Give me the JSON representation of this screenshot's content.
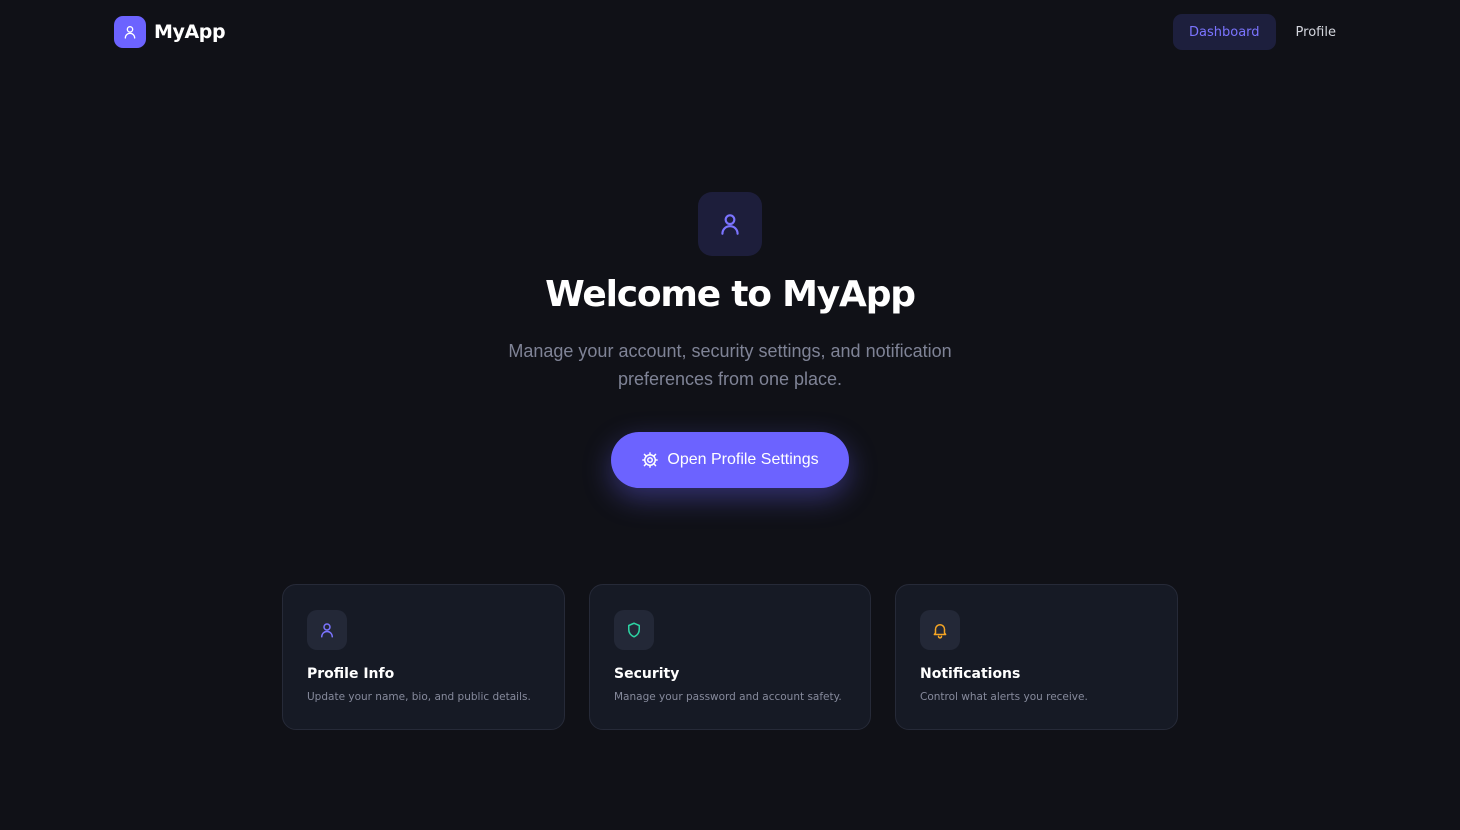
{
  "app": {
    "name": "MyApp",
    "accent_color": "#6c63ff",
    "background_color": "#101117"
  },
  "nav": {
    "items": [
      {
        "label": "Dashboard",
        "active": true
      },
      {
        "label": "Profile",
        "active": false
      }
    ]
  },
  "hero": {
    "icon": "user-icon",
    "title": "Welcome to MyApp",
    "subtitle": "Manage your account, security settings, and notification preferences from one place.",
    "cta": {
      "label": "Open Profile Settings",
      "icon": "gear-icon"
    }
  },
  "cards": [
    {
      "icon": "user-icon",
      "icon_color": "#7b74ff",
      "title": "Profile Info",
      "description": "Update your name, bio, and public details."
    },
    {
      "icon": "shield-icon",
      "icon_color": "#2dd4a3",
      "title": "Security",
      "description": "Manage your password and account safety."
    },
    {
      "icon": "bell-icon",
      "icon_color": "#f5a524",
      "title": "Notifications",
      "description": "Control what alerts you receive."
    }
  ]
}
